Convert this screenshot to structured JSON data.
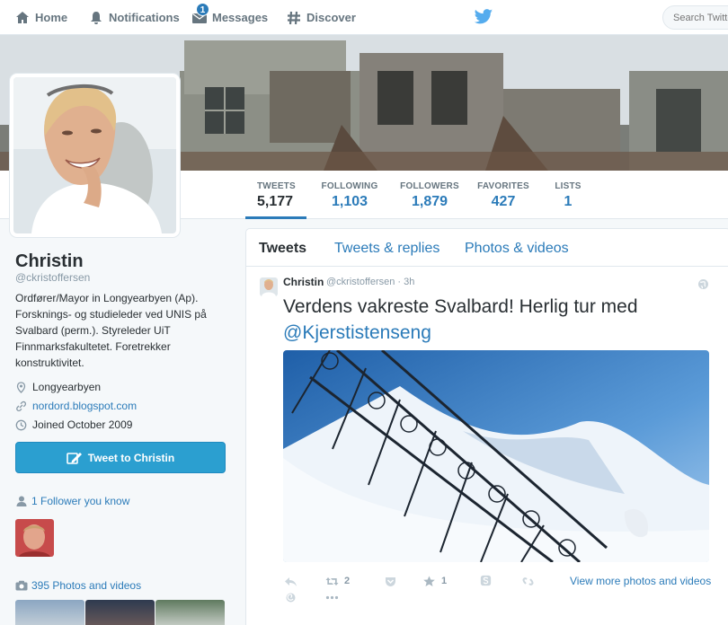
{
  "nav": {
    "home": "Home",
    "notifications": "Notifications",
    "messages": "Messages",
    "messages_badge": "1",
    "discover": "Discover",
    "search_placeholder": "Search Twitter"
  },
  "stats": [
    {
      "label": "TWEETS",
      "value": "5,177"
    },
    {
      "label": "FOLLOWING",
      "value": "1,103"
    },
    {
      "label": "FOLLOWERS",
      "value": "1,879"
    },
    {
      "label": "FAVORITES",
      "value": "427"
    },
    {
      "label": "LISTS",
      "value": "1"
    }
  ],
  "profile": {
    "name": "Christin",
    "handle": "@ckristoffersen",
    "bio": "Ordfører/Mayor in Longyearbyen (Ap).\nForsknings- og studieleder ved UNIS på\nSvalbard (perm.). Styreleder UiT\nFinnmarksfakultetet. Foretrekker\nkonstruktivitet.",
    "location": "Longyearbyen",
    "url": "nordord.blogspot.com",
    "joined": "Joined October 2009",
    "tweet_to_label": "Tweet to Christin",
    "followers_you_know": "1 Follower you know",
    "photos_videos": "395 Photos and videos"
  },
  "timeline": {
    "tabs": [
      "Tweets",
      "Tweets & replies",
      "Photos & videos"
    ],
    "tweet": {
      "name": "Christin",
      "handle": "@ckristoffersen · 3h",
      "text": "Verdens vakreste Svalbard! Herlig tur med ",
      "mention": "@Kjerstistenseng",
      "retweets": "2",
      "favorites": "1",
      "view_more": "View more photos and videos"
    }
  },
  "colors": {
    "accent": "#2b7bb9",
    "button": "#2b9fd0",
    "muted": "#8899a6"
  }
}
